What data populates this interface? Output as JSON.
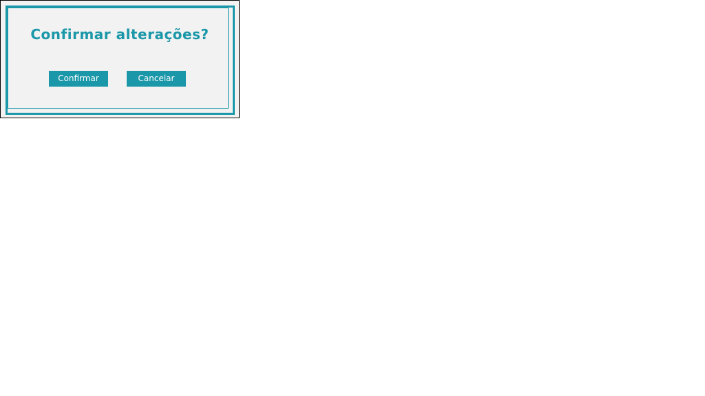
{
  "dialog": {
    "title": "Confirmar alterações?",
    "confirm_label": "Confirmar",
    "cancel_label": "Cancelar"
  },
  "colors": {
    "accent": "#1a97a8",
    "dialog_background": "#f2f2f2",
    "button_text": "#ffffff"
  }
}
